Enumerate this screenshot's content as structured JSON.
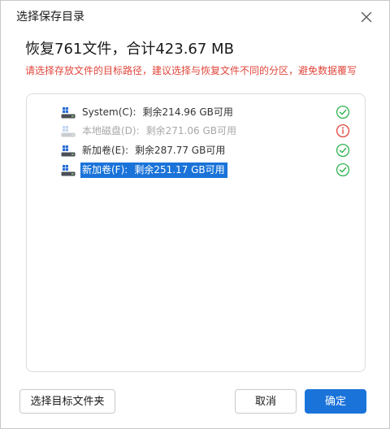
{
  "dialog": {
    "title": "选择保存目录",
    "close_icon": "close-icon"
  },
  "summary": {
    "heading": "恢复761文件，合计423.67 MB",
    "warning": "请选择存放文件的目标路径，建议选择与恢复文件不同的分区，避免数据覆写"
  },
  "drives": [
    {
      "label": "System(C):",
      "free": "剩余214.96 GB可用",
      "status": "ok",
      "icon": "windows-drive-icon",
      "disabled": false,
      "selected": false
    },
    {
      "label": "本地磁盘(D):",
      "free": "剩余271.06 GB可用",
      "status": "warning",
      "icon": "windows-drive-icon",
      "disabled": true,
      "selected": false
    },
    {
      "label": "新加卷(E):",
      "free": "剩余287.77 GB可用",
      "status": "ok",
      "icon": "windows-drive-icon",
      "disabled": false,
      "selected": false
    },
    {
      "label": "新加卷(F):",
      "free": "剩余251.17 GB可用",
      "status": "ok",
      "icon": "windows-drive-icon",
      "disabled": false,
      "selected": true
    }
  ],
  "buttons": {
    "select_folder": "选择目标文件夹",
    "cancel": "取消",
    "confirm": "确定"
  },
  "colors": {
    "accent": "#1a73d9",
    "warning_text": "#e0463b",
    "ok_status": "#2fb350",
    "error_status": "#e0463b"
  }
}
